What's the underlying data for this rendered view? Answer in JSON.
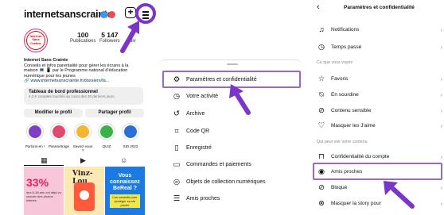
{
  "profile": {
    "username": "internetsanscrainte",
    "avatar_text": "Internet Sans Crainte",
    "stats": [
      {
        "value": "100",
        "label": "Publications"
      },
      {
        "value": "5 147",
        "label": "Followers"
      },
      {
        "value": "5",
        "label": "Suiv"
      }
    ],
    "bio_name": "Internet Sans Crainte",
    "bio_lines": [
      "Conseils et infos parentalité pour gérer les écrans à la",
      "maison 💻 📱 par le Programme national d'éducation",
      "numérique pour les jeunes"
    ],
    "link": "www.internetsanscrainte.fr/dossiers/fa...",
    "dashboard_title": "Tableau de bord professionnel",
    "dashboard_sub": "4,3 K comptes touchés au cours des 30 derniers jours.",
    "edit_button": "Modifier le profil",
    "share_button": "Partager profil",
    "highlights": [
      {
        "label": "Parlons-en !",
        "color": "#7e3fc5"
      },
      {
        "label": "Paramétrage",
        "color": "#e04a6f"
      },
      {
        "label": "Saviez-vous ?",
        "color": "#f2b632"
      },
      {
        "label": "QUIZ",
        "color": "#3ab24a"
      },
      {
        "label": "SID 2022",
        "color": "#2b6fd6"
      }
    ],
    "posts": {
      "p1_big": "33%",
      "p1_small": "des 6-18 ans ont déjà vu circuler des photos intimes",
      "p2_logo": "Vinz-Lou",
      "p3_title": "Vous connaissez BeReal ?",
      "p3_sub": "Les conseils pour protéger sa vie privée"
    }
  },
  "menu": {
    "items": [
      {
        "label": "Paramètres et confidentialité",
        "icon": "settings-gear-icon",
        "glyph": "⚙"
      },
      {
        "label": "Votre activité",
        "icon": "activity-icon",
        "glyph": "◷"
      },
      {
        "label": "Archive",
        "icon": "archive-icon",
        "glyph": "↺"
      },
      {
        "label": "Code QR",
        "icon": "qr-code-icon",
        "glyph": "⌗"
      },
      {
        "label": "Enregistré",
        "icon": "bookmark-icon",
        "glyph": "▯"
      },
      {
        "label": "Commandes et paiements",
        "icon": "card-icon",
        "glyph": "▭"
      },
      {
        "label": "Objets de collection numériques",
        "icon": "collectible-icon",
        "glyph": "◎"
      },
      {
        "label": "Amis proches",
        "icon": "close-friends-list-icon",
        "glyph": "☰"
      }
    ]
  },
  "settings": {
    "title": "Paramètres et confidentialité",
    "items_top": [
      {
        "label": "Notifications",
        "icon": "bell-icon",
        "glyph": "🔔"
      },
      {
        "label": "Temps passé",
        "icon": "clock-icon",
        "glyph": "◷"
      }
    ],
    "section1": "Ce que vous voyez",
    "items_see": [
      {
        "label": "Favoris",
        "icon": "star-icon",
        "glyph": "☆"
      },
      {
        "label": "En sourdine",
        "icon": "mute-icon",
        "glyph": "🔕"
      },
      {
        "label": "Contenu sensible",
        "icon": "sensitive-icon",
        "glyph": "⊘"
      },
      {
        "label": "Masquer les J'aime",
        "icon": "heart-off-icon",
        "glyph": "♡"
      }
    ],
    "section2": "Qui peut voir votre contenu",
    "items_who": [
      {
        "label": "Confidentialité du compte",
        "icon": "lock-icon",
        "glyph": "🔒"
      },
      {
        "label": "Amis proches",
        "icon": "close-friends-icon",
        "glyph": "◉"
      },
      {
        "label": "Bloqué",
        "icon": "blocked-icon",
        "glyph": "⊘"
      },
      {
        "label": "Masquer la story pour",
        "icon": "hide-story-icon",
        "glyph": "⊗"
      }
    ]
  },
  "colors": {
    "accent": "#7b35c9",
    "highlight": "#9a63d6",
    "link": "#00376b"
  }
}
